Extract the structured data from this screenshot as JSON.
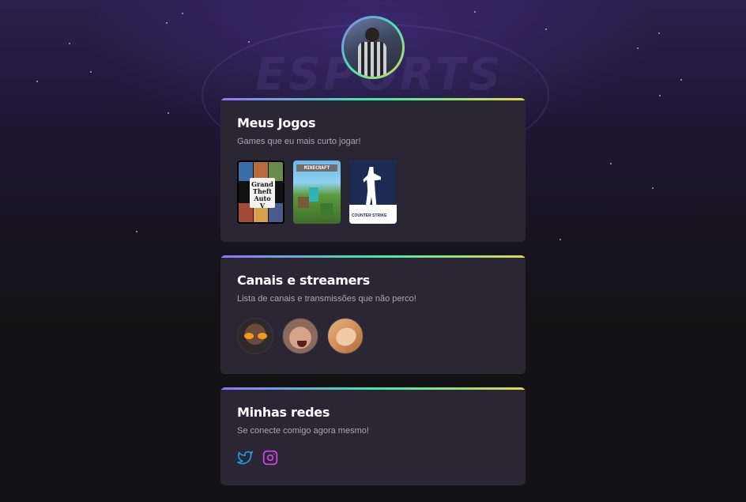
{
  "colors": {
    "background": "#121214",
    "card": "#2a2634",
    "gradient": [
      "#9572fc",
      "#43e7ad",
      "#e2d45c"
    ],
    "subtitle": "#a8a8b3",
    "twitter": "#1d9bf0",
    "instagram": "#d946ef"
  },
  "background": {
    "emblem_text": "ESPORTS"
  },
  "profile": {
    "avatar_icon": "profile-photo"
  },
  "sections": {
    "games": {
      "title": "Meus Jogos",
      "subtitle": "Games que eu mais curto jogar!",
      "items": [
        {
          "name": "gta-v-cover",
          "logo_lines": [
            "Grand",
            "Theft",
            "Auto",
            "V"
          ]
        },
        {
          "name": "minecraft-cover",
          "logo": "MINECRAFT"
        },
        {
          "name": "counter-strike-cover",
          "logo": "COUNTER STRIKE"
        }
      ]
    },
    "channels": {
      "title": "Canais e streamers",
      "subtitle": "Lista de canais e transmissões que não perco!",
      "items": [
        "streamer-avatar-1",
        "streamer-avatar-2",
        "streamer-avatar-3"
      ]
    },
    "socials": {
      "title": "Minhas redes",
      "subtitle": "Se conecte comigo agora mesmo!",
      "items": [
        "twitter-icon",
        "instagram-icon"
      ]
    }
  }
}
